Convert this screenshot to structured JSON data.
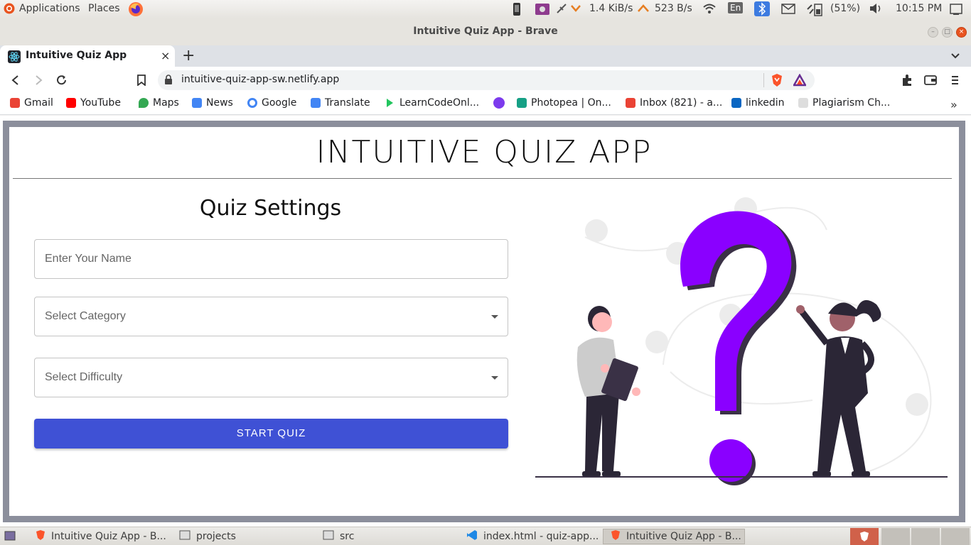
{
  "top_panel": {
    "applications": "Applications",
    "places": "Places",
    "net_down": "1.4 KiB/s",
    "net_up": "523 B/s",
    "keyboard_layout": "En",
    "battery": "(51%)",
    "clock": "10:15 PM"
  },
  "window": {
    "title": "Intuitive Quiz App - Brave"
  },
  "browser": {
    "tab_title": "Intuitive Quiz App",
    "url": "intuitive-quiz-app-sw.netlify.app",
    "bookmarks": [
      {
        "label": "Gmail",
        "color": "#ea4335"
      },
      {
        "label": "YouTube",
        "color": "#ff0000"
      },
      {
        "label": "Maps",
        "color": "#34a853"
      },
      {
        "label": "News",
        "color": "#4285f4"
      },
      {
        "label": "Google",
        "color": "#4285f4"
      },
      {
        "label": "Translate",
        "color": "#4285f4"
      },
      {
        "label": "LearnCodeOnl...",
        "color": "#22c55e"
      },
      {
        "label": "",
        "color": "#7c3aed"
      },
      {
        "label": "Photopea | On...",
        "color": "#16a085"
      },
      {
        "label": "Inbox (821) - a...",
        "color": "#ea4335"
      },
      {
        "label": "linkedin",
        "color": "#0a66c2"
      },
      {
        "label": "Plagiarism Ch...",
        "color": "#888888"
      }
    ]
  },
  "app": {
    "title": "INTUITIVE QUIZ APP",
    "settings_title": "Quiz Settings",
    "name_placeholder": "Enter Your Name",
    "category_placeholder": "Select Category",
    "difficulty_placeholder": "Select Difficulty",
    "start_label": "START QUIZ",
    "accent_color": "#3f51d5",
    "illustration_accent": "#8a00ff"
  },
  "taskbar": {
    "items": [
      "Intuitive Quiz App - B...",
      "projects",
      "src",
      "index.html - quiz-app...",
      "Intuitive Quiz App - B..."
    ]
  }
}
